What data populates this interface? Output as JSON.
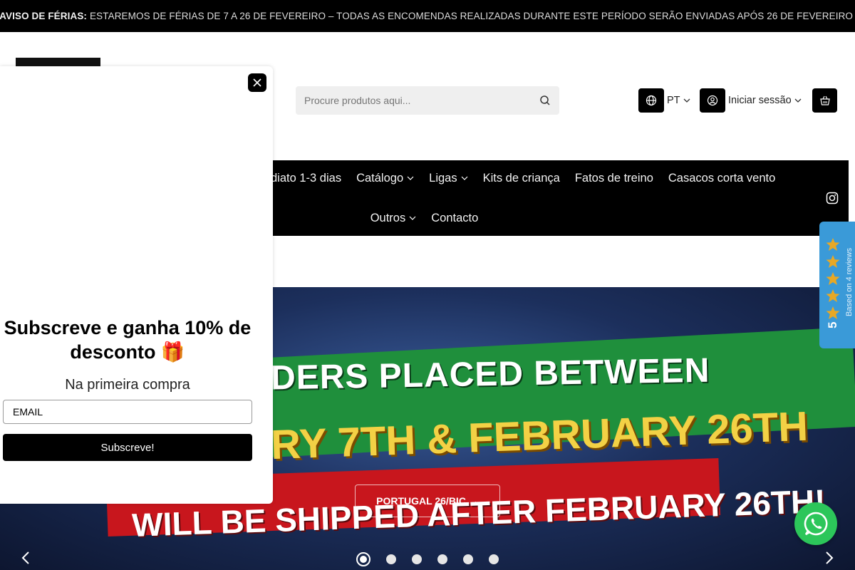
{
  "announcement": {
    "emoji": "🔥🌴",
    "label": "AVISO DE FÉRIAS:",
    "text": "ESTAREMOS DE FÉRIAS DE 7 A 26 DE FEVEREIRO – TODAS AS ENCOMENDAS REALIZADAS DURANTE ESTE PERÍODO SERÃO ENVIADAS APÓS 26 DE FEVEREIRO 📦✨"
  },
  "header": {
    "search_placeholder": "Procure produtos aqui...",
    "language": "PT",
    "login": "Iniciar sessão"
  },
  "nav": {
    "row1": [
      {
        "label": "diato 1-3 dias",
        "dropdown": false
      },
      {
        "label": "Catálogo",
        "dropdown": true
      },
      {
        "label": "Ligas",
        "dropdown": true
      },
      {
        "label": "Kits de criança",
        "dropdown": false
      },
      {
        "label": "Fatos de treino",
        "dropdown": false
      },
      {
        "label": "Casacos corta vento",
        "dropdown": false
      }
    ],
    "row2": [
      {
        "label": "Outros",
        "dropdown": true
      },
      {
        "label": "Contacto",
        "dropdown": false
      }
    ]
  },
  "hero": {
    "line1": "DERS PLACED BETWEEN",
    "line2": "RY 7TH & FEBRUARY 26TH",
    "line3": "WILL BE SHIPPED AFTER FEBRUARY 26TH!",
    "cta": "PORTUGAL 26/BIC →",
    "slide_count": 6,
    "active_slide": 0
  },
  "reviews": {
    "score": "5",
    "text": "Based on 4 reviews",
    "star_color": "#e8a825",
    "stars": 5
  },
  "popup": {
    "title": "Subscreve e ganha 10% de desconto 🎁",
    "subtitle": "Na primeira compra",
    "email_placeholder": "EMAIL",
    "submit": "Subscreve!"
  },
  "colors": {
    "accent": "#000000",
    "reviews_badge": "#3a9ad8",
    "whatsapp": "#2cc65a"
  }
}
